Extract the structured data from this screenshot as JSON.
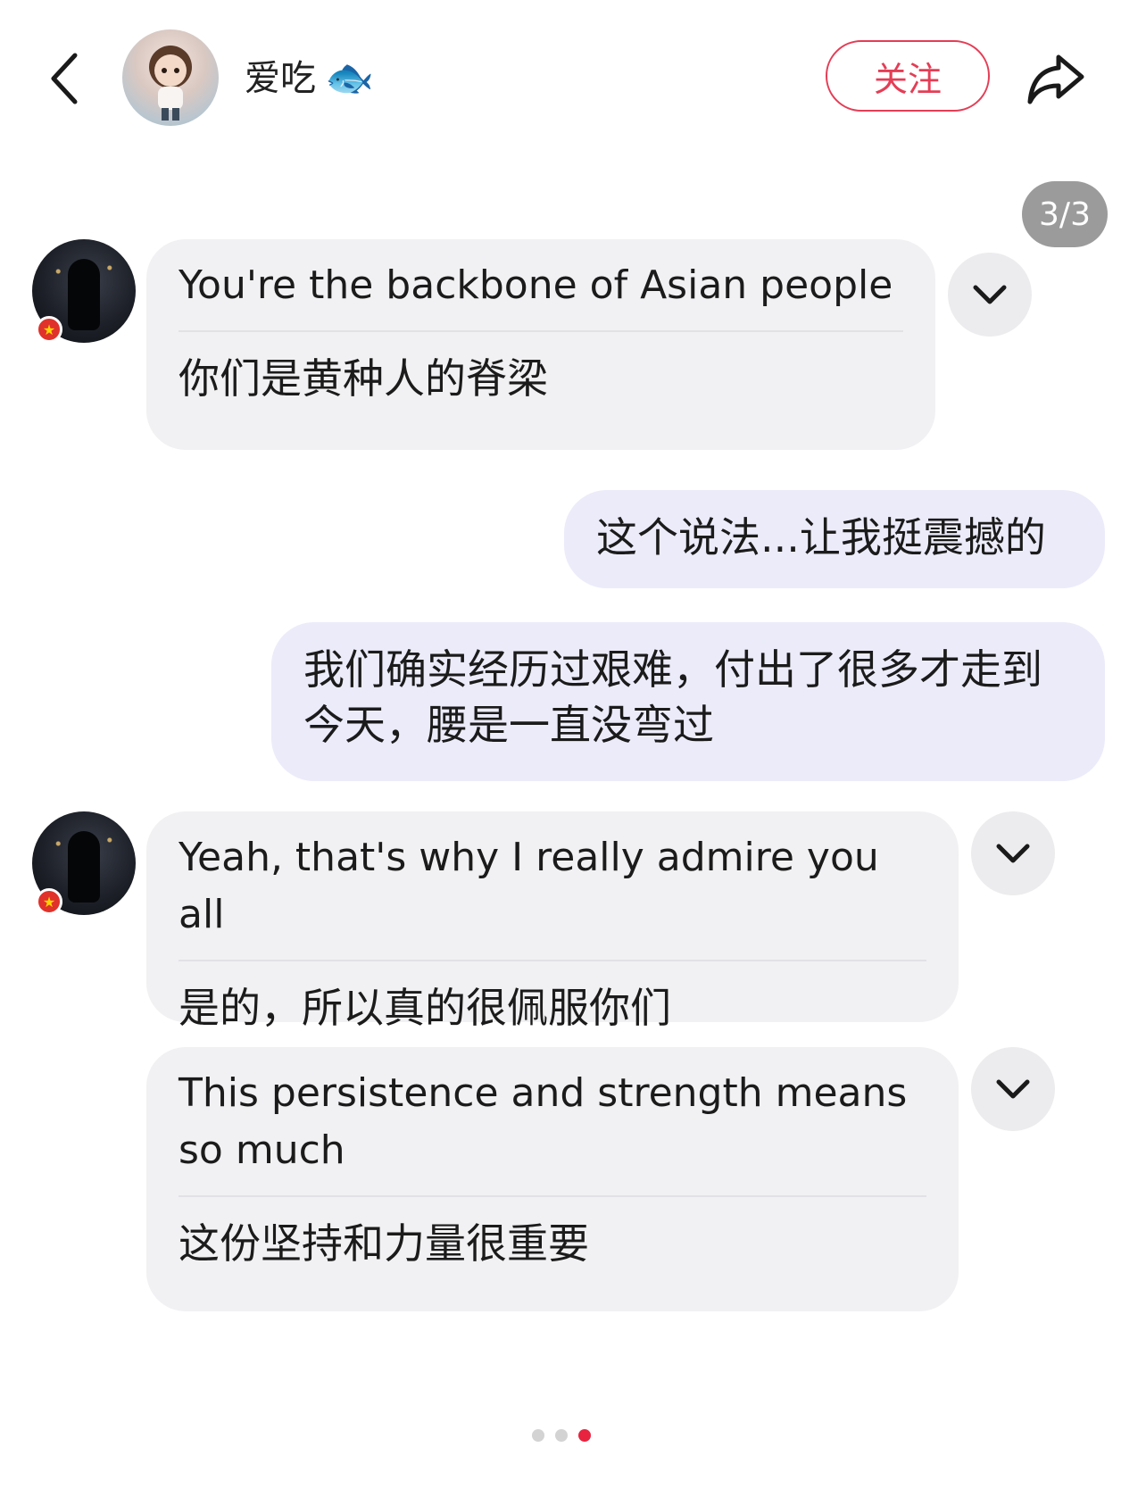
{
  "header": {
    "author_name": "爱吃",
    "author_emoji": "🐟",
    "follow_label": "关注"
  },
  "page_indicator": "3/3",
  "messages": [
    {
      "en": "You're the backbone of Asian people",
      "zh": "你们是黄种人的脊梁"
    },
    {
      "text": "这个说法...让我挺震撼的"
    },
    {
      "text": "我们确实经历过艰难，付出了很多才走到今天，腰是一直没弯过"
    },
    {
      "en": "Yeah, that's why I really admire you all",
      "zh": "是的，所以真的很佩服你们"
    },
    {
      "en": "This persistence and strength means so much",
      "zh": "这份坚持和力量很重要"
    }
  ],
  "carousel": {
    "count": 3,
    "active_index": 2
  },
  "colors": {
    "accent": "#e43d55",
    "incoming_bubble": "#f1f1f3",
    "outgoing_bubble": "#ecebfa",
    "badge_gray": "#9b9b9b"
  },
  "icons": {
    "back": "chevron-left-icon",
    "share": "share-arrow-icon",
    "expand": "chevron-down-icon",
    "flag": "vietnam-flag-icon"
  }
}
